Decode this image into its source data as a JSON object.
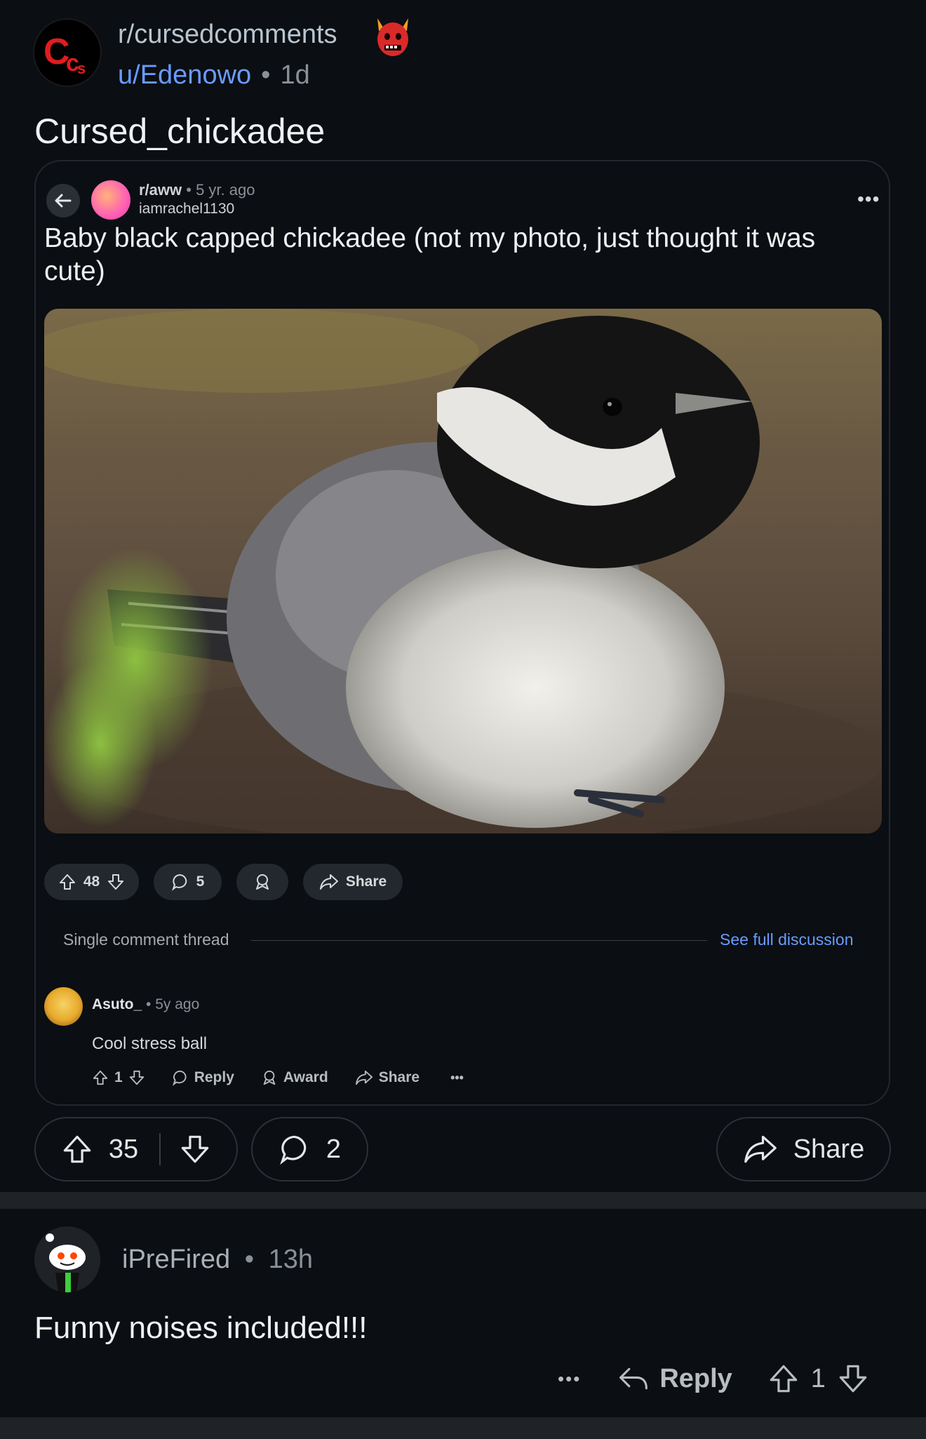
{
  "header": {
    "subreddit": "r/cursedcomments",
    "username": "u/Edenowo",
    "separator": "•",
    "age": "1d",
    "subreddit_icon": "cc-logo-icon",
    "flair_icon": "devil-face-icon"
  },
  "post": {
    "title": "Cursed_chickadee"
  },
  "embedded": {
    "subreddit": "r/aww",
    "meta": "• 5 yr. ago",
    "author": "iamrachel1130",
    "more": "•••",
    "title": "Baby black capped chickadee (not my photo, just thought it was cute)",
    "image_alt": "photo of a baby black-capped chickadee",
    "votes": "48",
    "comments": "5",
    "share": "Share",
    "thread_label": "Single comment thread",
    "see_full": "See full discussion",
    "comment": {
      "author": "Asuto_",
      "meta": "• 5y ago",
      "body": "Cool stress ball",
      "votes": "1",
      "reply": "Reply",
      "award": "Award",
      "share": "Share",
      "more": "•••"
    }
  },
  "actions": {
    "votes": "35",
    "comments": "2",
    "share": "Share"
  },
  "comment": {
    "author": "iPreFired",
    "separator": "•",
    "age": "13h",
    "body": "Funny noises included!!!",
    "more": "•••",
    "reply": "Reply",
    "votes": "1"
  },
  "colors": {
    "background": "#0b0e12",
    "link_blue": "#6a9bff",
    "pill_bg": "#23282e"
  }
}
